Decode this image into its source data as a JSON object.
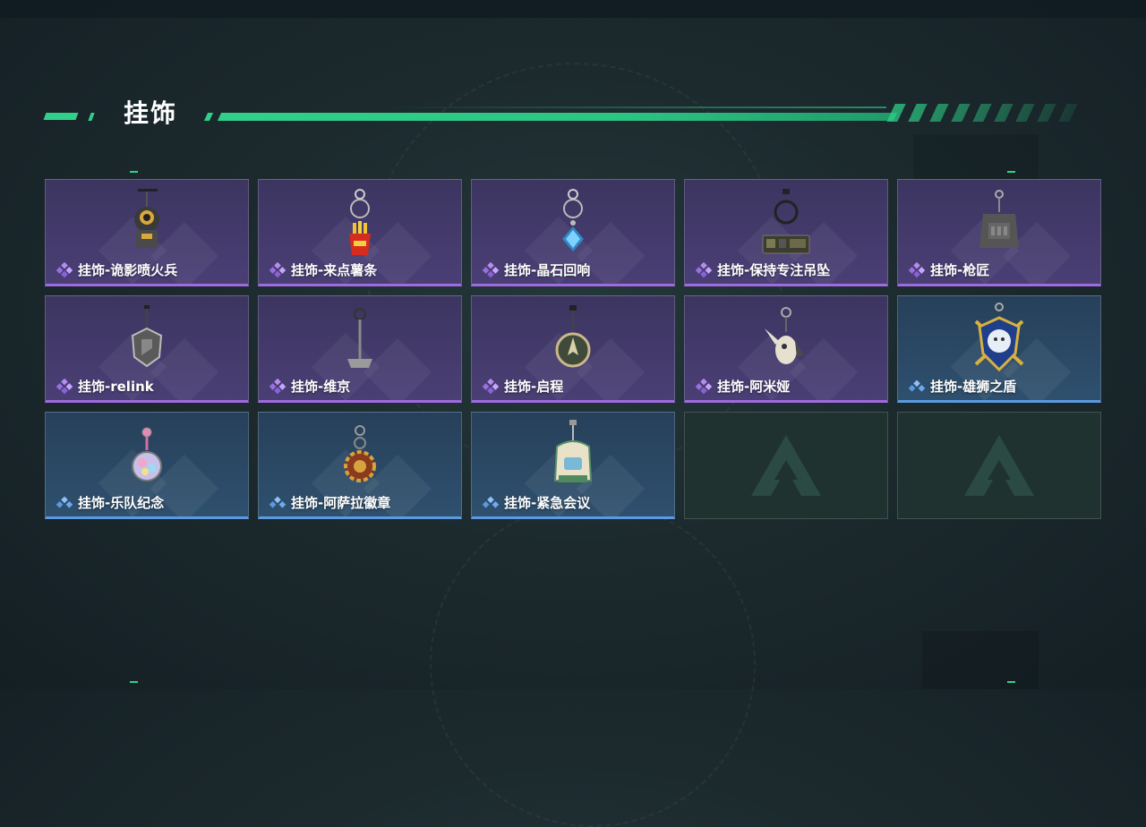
{
  "page": {
    "title": "挂饰"
  },
  "theme": {
    "accent": "#2fd18a",
    "purple_rarity": "#a06ae0",
    "blue_rarity": "#5c9ae0"
  },
  "items": [
    {
      "name": "挂饰-诡影喷火兵",
      "rarity": "purple",
      "icon": "flame-soldier-charm-icon"
    },
    {
      "name": "挂饰-来点薯条",
      "rarity": "purple",
      "icon": "fries-charm-icon"
    },
    {
      "name": "挂饰-晶石回响",
      "rarity": "purple",
      "icon": "crystal-charm-icon"
    },
    {
      "name": "挂饰-保持专注吊坠",
      "rarity": "purple",
      "icon": "stay-focused-tag-icon"
    },
    {
      "name": "挂饰-枪匠",
      "rarity": "purple",
      "icon": "gunsmith-vest-icon"
    },
    {
      "name": "挂饰-relink",
      "rarity": "purple",
      "icon": "relink-shield-icon"
    },
    {
      "name": "挂饰-维京",
      "rarity": "purple",
      "icon": "viking-hammer-icon"
    },
    {
      "name": "挂饰-启程",
      "rarity": "purple",
      "icon": "compass-medallion-icon"
    },
    {
      "name": "挂饰-阿米娅",
      "rarity": "purple",
      "icon": "rabbit-figure-icon"
    },
    {
      "name": "挂饰-雄狮之盾",
      "rarity": "blue",
      "icon": "lion-shield-icon"
    },
    {
      "name": "挂饰-乐队纪念",
      "rarity": "blue",
      "icon": "band-badge-icon"
    },
    {
      "name": "挂饰-阿萨拉徽章",
      "rarity": "blue",
      "icon": "sun-emblem-icon"
    },
    {
      "name": "挂饰-紧急会议",
      "rarity": "blue",
      "icon": "emergency-meeting-icon"
    },
    {
      "name": "",
      "rarity": "empty",
      "icon": "delta-logo-icon"
    },
    {
      "name": "",
      "rarity": "empty",
      "icon": "delta-logo-icon"
    }
  ]
}
